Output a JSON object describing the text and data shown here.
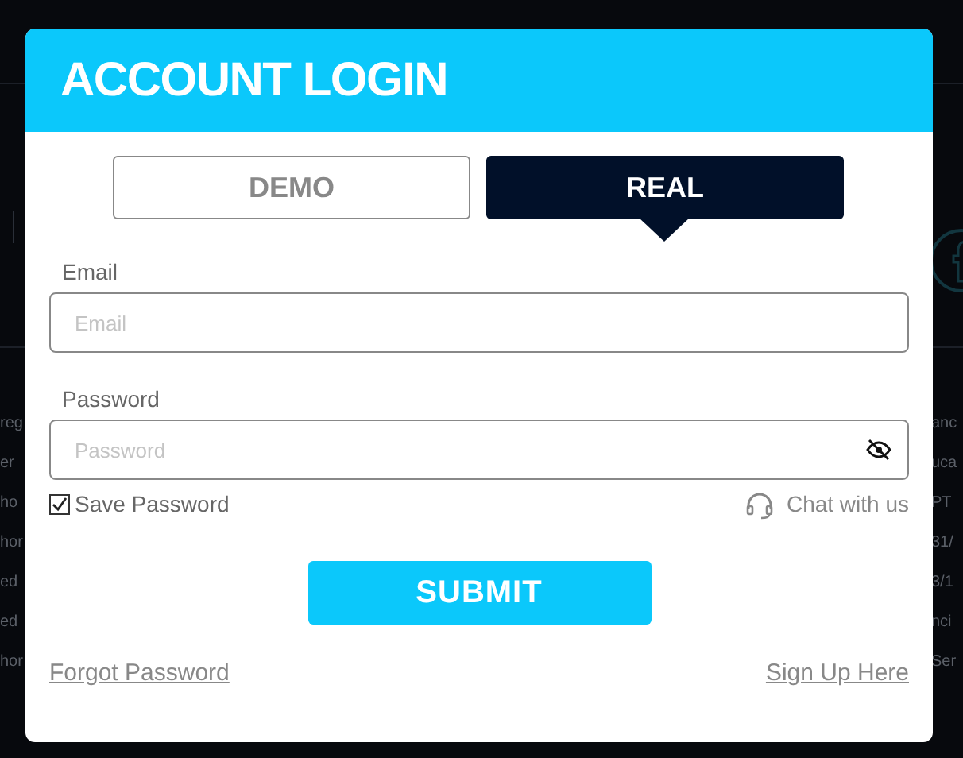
{
  "background": {
    "left_fragments": [
      "reg",
      "er",
      "ho",
      "hor",
      "ed",
      "ed",
      "hor"
    ],
    "right_fragments": [
      "anc",
      "uca",
      "PT",
      "31/",
      "3/1",
      "nci",
      "Ser"
    ]
  },
  "dialog": {
    "title": "ACCOUNT LOGIN",
    "tabs": [
      {
        "label": "DEMO",
        "selected": false
      },
      {
        "label": "REAL",
        "selected": true
      }
    ],
    "email": {
      "label": "Email",
      "placeholder": "Email"
    },
    "password": {
      "label": "Password",
      "placeholder": "Password"
    },
    "save_password": {
      "label": "Save Password",
      "checked": true
    },
    "chat_link": "Chat with us",
    "submit": "SUBMIT",
    "forgot_link": "Forgot Password",
    "signup_link": "Sign Up Here"
  }
}
